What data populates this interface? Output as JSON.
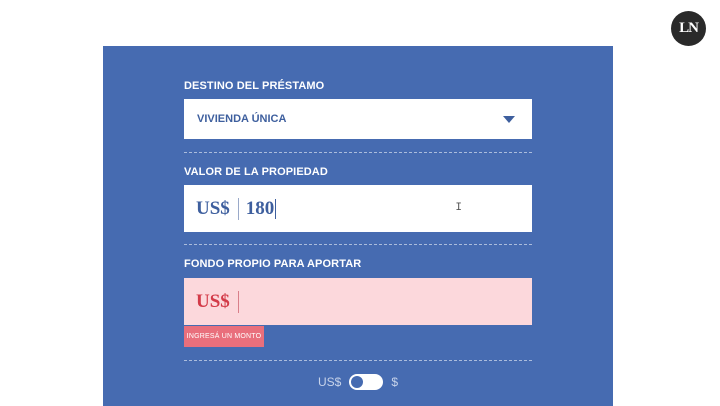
{
  "logo": {
    "text": "LN"
  },
  "form": {
    "destino": {
      "label": "DESTINO DEL PRÉSTAMO",
      "value": "VIVIENDA ÚNICA"
    },
    "valor": {
      "label": "VALOR DE LA PROPIEDAD",
      "currency": "US$",
      "value": "180"
    },
    "fondo": {
      "label": "FONDO PROPIO PARA APORTAR",
      "currency": "US$",
      "value": "",
      "error": "INGRESÁ UN MONTO"
    },
    "toggle": {
      "left_label": "US$",
      "right_label": "$"
    }
  },
  "colors": {
    "panel": "#466bb1",
    "accent_text": "#3e5f9e",
    "error_bg": "#fcd8dc",
    "error_tag": "#e96f7c",
    "error_text": "#d33a48"
  }
}
